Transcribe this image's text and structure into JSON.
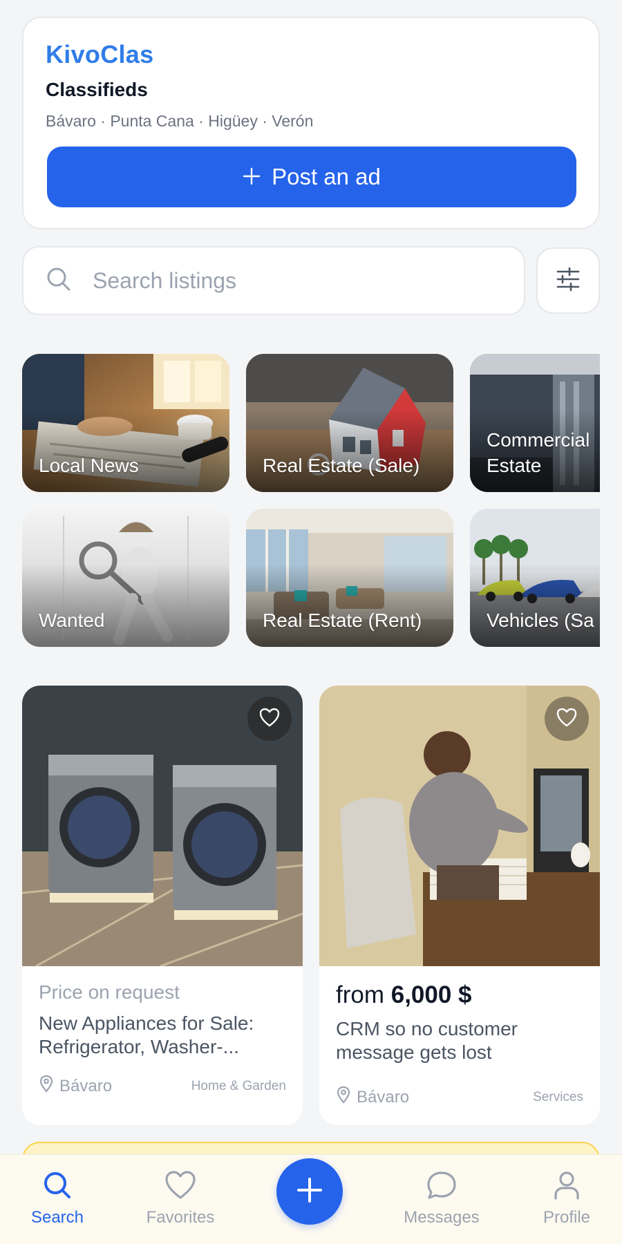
{
  "header": {
    "brand": "KivoClas",
    "subtitle": "Classifieds",
    "cities": "Bávaro · Punta Cana · Higüey · Verón",
    "post_button": "Post an ad"
  },
  "search": {
    "placeholder": "Search listings",
    "value": ""
  },
  "categories": [
    {
      "label": "Local News"
    },
    {
      "label": "Real Estate (Sale)"
    },
    {
      "label": "Commercial Estate"
    },
    {
      "label": "Wanted"
    },
    {
      "label": "Real Estate (Rent)"
    },
    {
      "label": "Vehicles (Sa"
    }
  ],
  "listings": [
    {
      "price": "Price on request",
      "title": "New Appliances for Sale: Refrigerator, Washer-...",
      "location": "Bávaro",
      "category": "Home & Garden"
    },
    {
      "price_prefix": "from",
      "price_value": "6,000 $",
      "title": "CRM so no customer message gets lost",
      "location": "Bávaro",
      "category": "Services"
    }
  ],
  "nav": {
    "search": "Search",
    "favorites": "Favorites",
    "messages": "Messages",
    "profile": "Profile"
  },
  "colors": {
    "accent": "#2563eb",
    "brand": "#2f7de8",
    "background": "#f4f5f6"
  }
}
